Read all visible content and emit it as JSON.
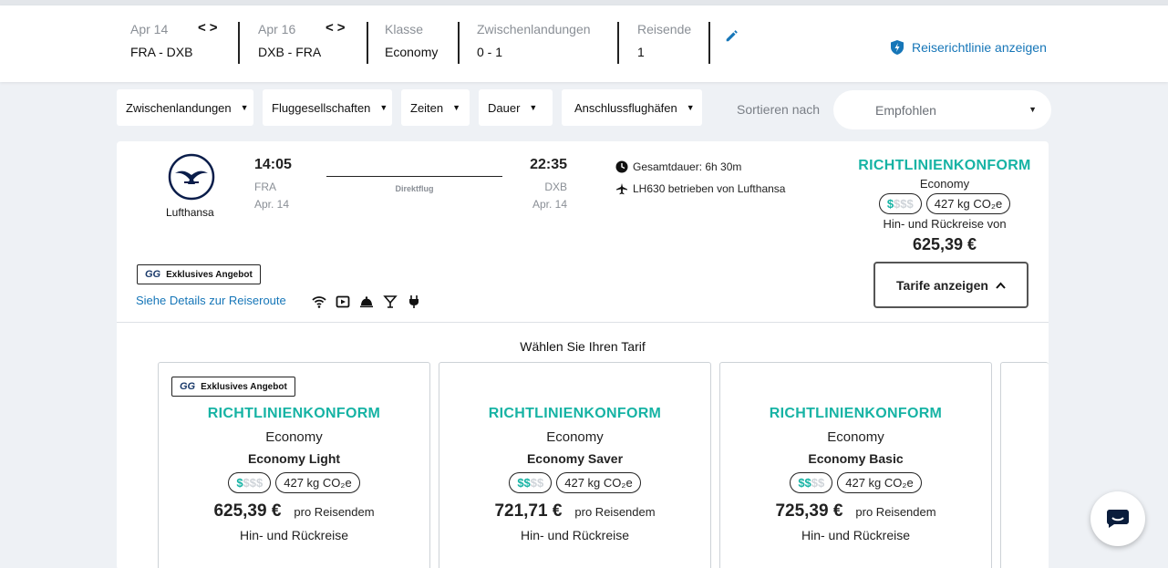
{
  "search": {
    "leg1": {
      "date": "Apr 14",
      "route": "FRA - DXB"
    },
    "leg2": {
      "date": "Apr 16",
      "route": "DXB - FRA"
    },
    "class": {
      "label": "Klasse",
      "value": "Economy"
    },
    "stops": {
      "label": "Zwischenlandungen",
      "value": "0 - 1"
    },
    "travelers": {
      "label": "Reisende",
      "value": "1"
    },
    "policy_link": "Reiserichtlinie anzeigen"
  },
  "filters": {
    "stops": "Zwischenlandungen",
    "airlines": "Fluggesellschaften",
    "times": "Zeiten",
    "duration": "Dauer",
    "connections": "Anschlussflughäfen",
    "sort_label": "Sortieren nach",
    "sort_value": "Empfohlen"
  },
  "flight": {
    "airline": "Lufthansa",
    "dep_time": "14:05",
    "dep_airport": "FRA",
    "dep_date": "Apr. 14",
    "arr_time": "22:35",
    "arr_airport": "DXB",
    "arr_date": "Apr. 14",
    "stop_type": "Direktflug",
    "duration": "Gesamtdauer: 6h 30m",
    "operated": "LH630 betrieben von Lufthansa",
    "policy_status": "RICHTLINIENKONFORM",
    "cabin": "Economy",
    "co2": "427 kg CO₂e",
    "roundtrip_from": "Hin- und Rückreise von",
    "price": "625,39 €",
    "show_fares": "Tarife anzeigen",
    "exclusive": "Exklusives Angebot",
    "details_link": "Siehe Details zur Reiseroute",
    "cost_level": 1,
    "accent": "#16b3a4"
  },
  "fares_title": "Wählen Sie Ihren Tarif",
  "fares": [
    {
      "badge": "Exklusives Angebot",
      "status": "RICHTLINIENKONFORM",
      "cabin": "Economy",
      "name": "Economy Light",
      "co2": "427 kg CO₂e",
      "price": "625,39 €",
      "per": "pro Reisendem",
      "trip": "Hin- und Rückreise",
      "cost_level": 1
    },
    {
      "badge": "",
      "status": "RICHTLINIENKONFORM",
      "cabin": "Economy",
      "name": "Economy Saver",
      "co2": "427 kg CO₂e",
      "price": "721,71 €",
      "per": "pro Reisendem",
      "trip": "Hin- und Rückreise",
      "cost_level": 2
    },
    {
      "badge": "",
      "status": "RICHTLINIENKONFORM",
      "cabin": "Economy",
      "name": "Economy Basic",
      "co2": "427 kg CO₂e",
      "price": "725,39 €",
      "per": "pro Reisendem",
      "trip": "Hin- und Rückreise",
      "cost_level": 2
    }
  ]
}
